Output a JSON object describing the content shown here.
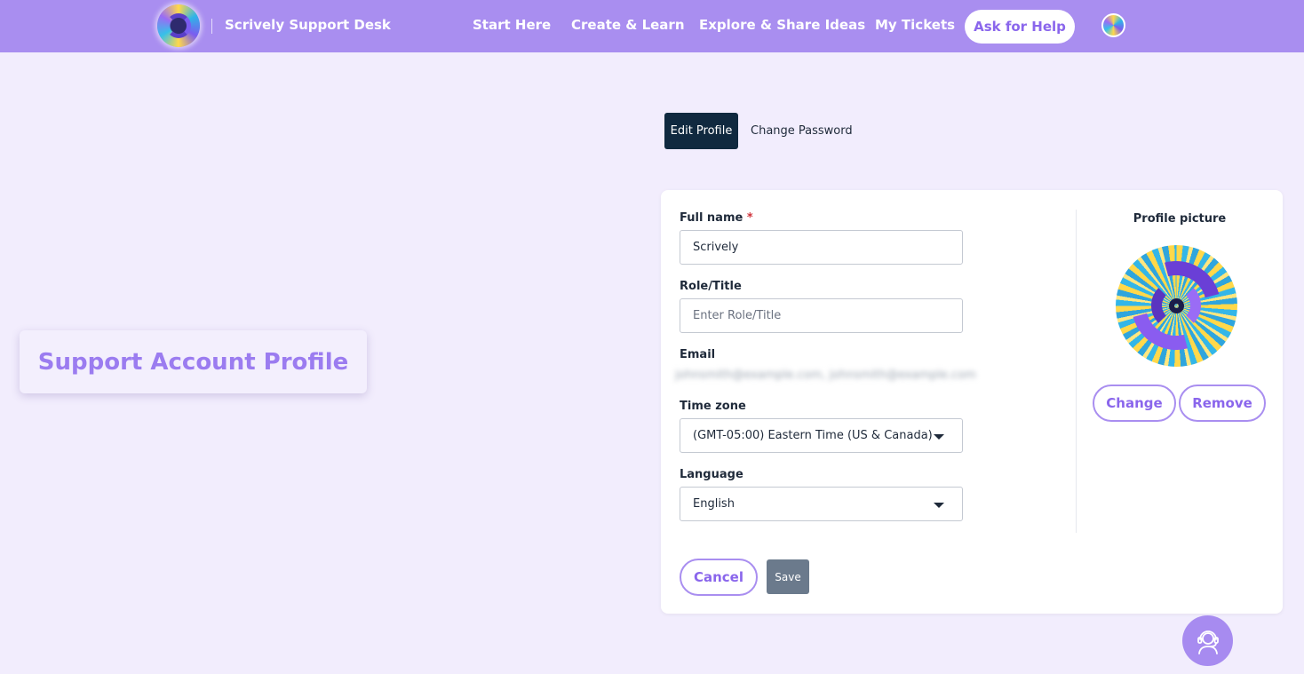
{
  "header": {
    "brand": "Scrively Support Desk",
    "nav": [
      "Start Here",
      "Create & Learn",
      "Explore & Share Ideas",
      "My Tickets"
    ],
    "cta": "Ask for Help",
    "logo_icon": "scrively-logo-icon",
    "avatar_icon": "user-avatar-icon"
  },
  "page": {
    "title": "Support Account Profile"
  },
  "tabs": {
    "edit": "Edit Profile",
    "password": "Change Password"
  },
  "form": {
    "full_name_label": "Full name",
    "required_mark": "*",
    "full_name_value": "Scrively",
    "role_label": "Role/Title",
    "role_placeholder": "Enter Role/Title",
    "email_label": "Email",
    "email_value": "johnsmith@example.com, johnsmith@example.com",
    "timezone_label": "Time zone",
    "timezone_value": "(GMT-05:00) Eastern Time (US & Canada)",
    "language_label": "Language",
    "language_value": "English",
    "cancel": "Cancel",
    "save": "Save"
  },
  "profile_picture": {
    "label": "Profile picture",
    "change": "Change",
    "remove": "Remove"
  },
  "colors": {
    "accent": "#a98ef0",
    "accent_text": "#8a66ec",
    "background": "#f2edfd",
    "tab_active": "#10293f",
    "save_button": "#6b7a8c"
  },
  "help_fab_icon": "support-agent-icon"
}
